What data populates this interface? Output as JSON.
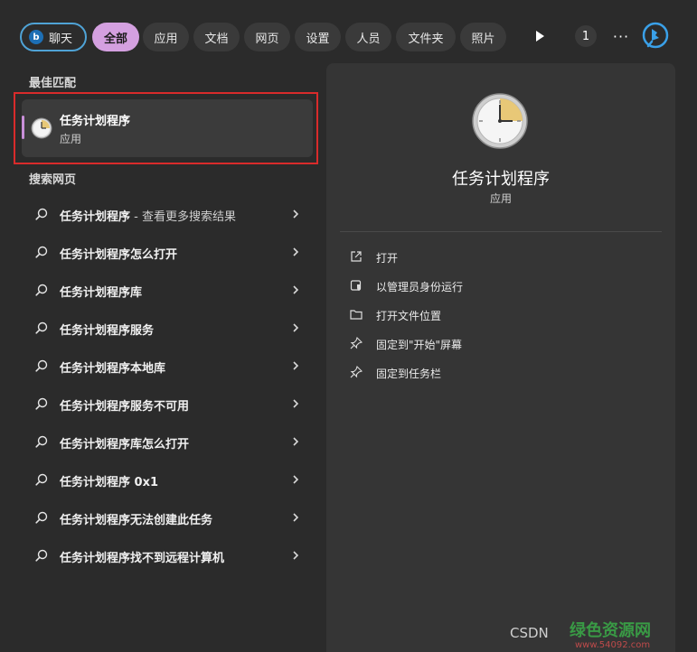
{
  "filters": {
    "chat_label": "聊天",
    "items": [
      "全部",
      "应用",
      "文档",
      "网页",
      "设置",
      "人员",
      "文件夹",
      "照片"
    ],
    "count": "1",
    "more_label": "···"
  },
  "best_match": {
    "section_title": "最佳匹配",
    "name": "任务计划程序",
    "type": "应用"
  },
  "web": {
    "section_title": "搜索网页",
    "items": [
      {
        "label": "任务计划程序",
        "sub": " - 查看更多搜索结果"
      },
      {
        "label": "任务计划程序怎么打开",
        "sub": ""
      },
      {
        "label": "任务计划程序库",
        "sub": ""
      },
      {
        "label": "任务计划程序服务",
        "sub": ""
      },
      {
        "label": "任务计划程序本地库",
        "sub": ""
      },
      {
        "label": "任务计划程序服务不可用",
        "sub": ""
      },
      {
        "label": "任务计划程序库怎么打开",
        "sub": ""
      },
      {
        "label": "任务计划程序 0x1",
        "sub": ""
      },
      {
        "label": "任务计划程序无法创建此任务",
        "sub": ""
      },
      {
        "label": "任务计划程序找不到远程计算机",
        "sub": ""
      }
    ]
  },
  "detail": {
    "title": "任务计划程序",
    "subtitle": "应用",
    "actions": [
      {
        "label": "打开",
        "icon": "open-external-icon"
      },
      {
        "label": "以管理员身份运行",
        "icon": "admin-shield-icon"
      },
      {
        "label": "打开文件位置",
        "icon": "folder-icon"
      },
      {
        "label": "固定到\"开始\"屏幕",
        "icon": "pin-icon"
      },
      {
        "label": "固定到任务栏",
        "icon": "pin-icon"
      }
    ]
  },
  "watermark": {
    "csdn": "CSDN",
    "site": "绿色资源网",
    "site_url": "www.54092.com"
  },
  "colors": {
    "accent_pill": "#d4a0e0",
    "highlight_border": "#d92b2b",
    "chat_border": "#4fa3d6"
  }
}
